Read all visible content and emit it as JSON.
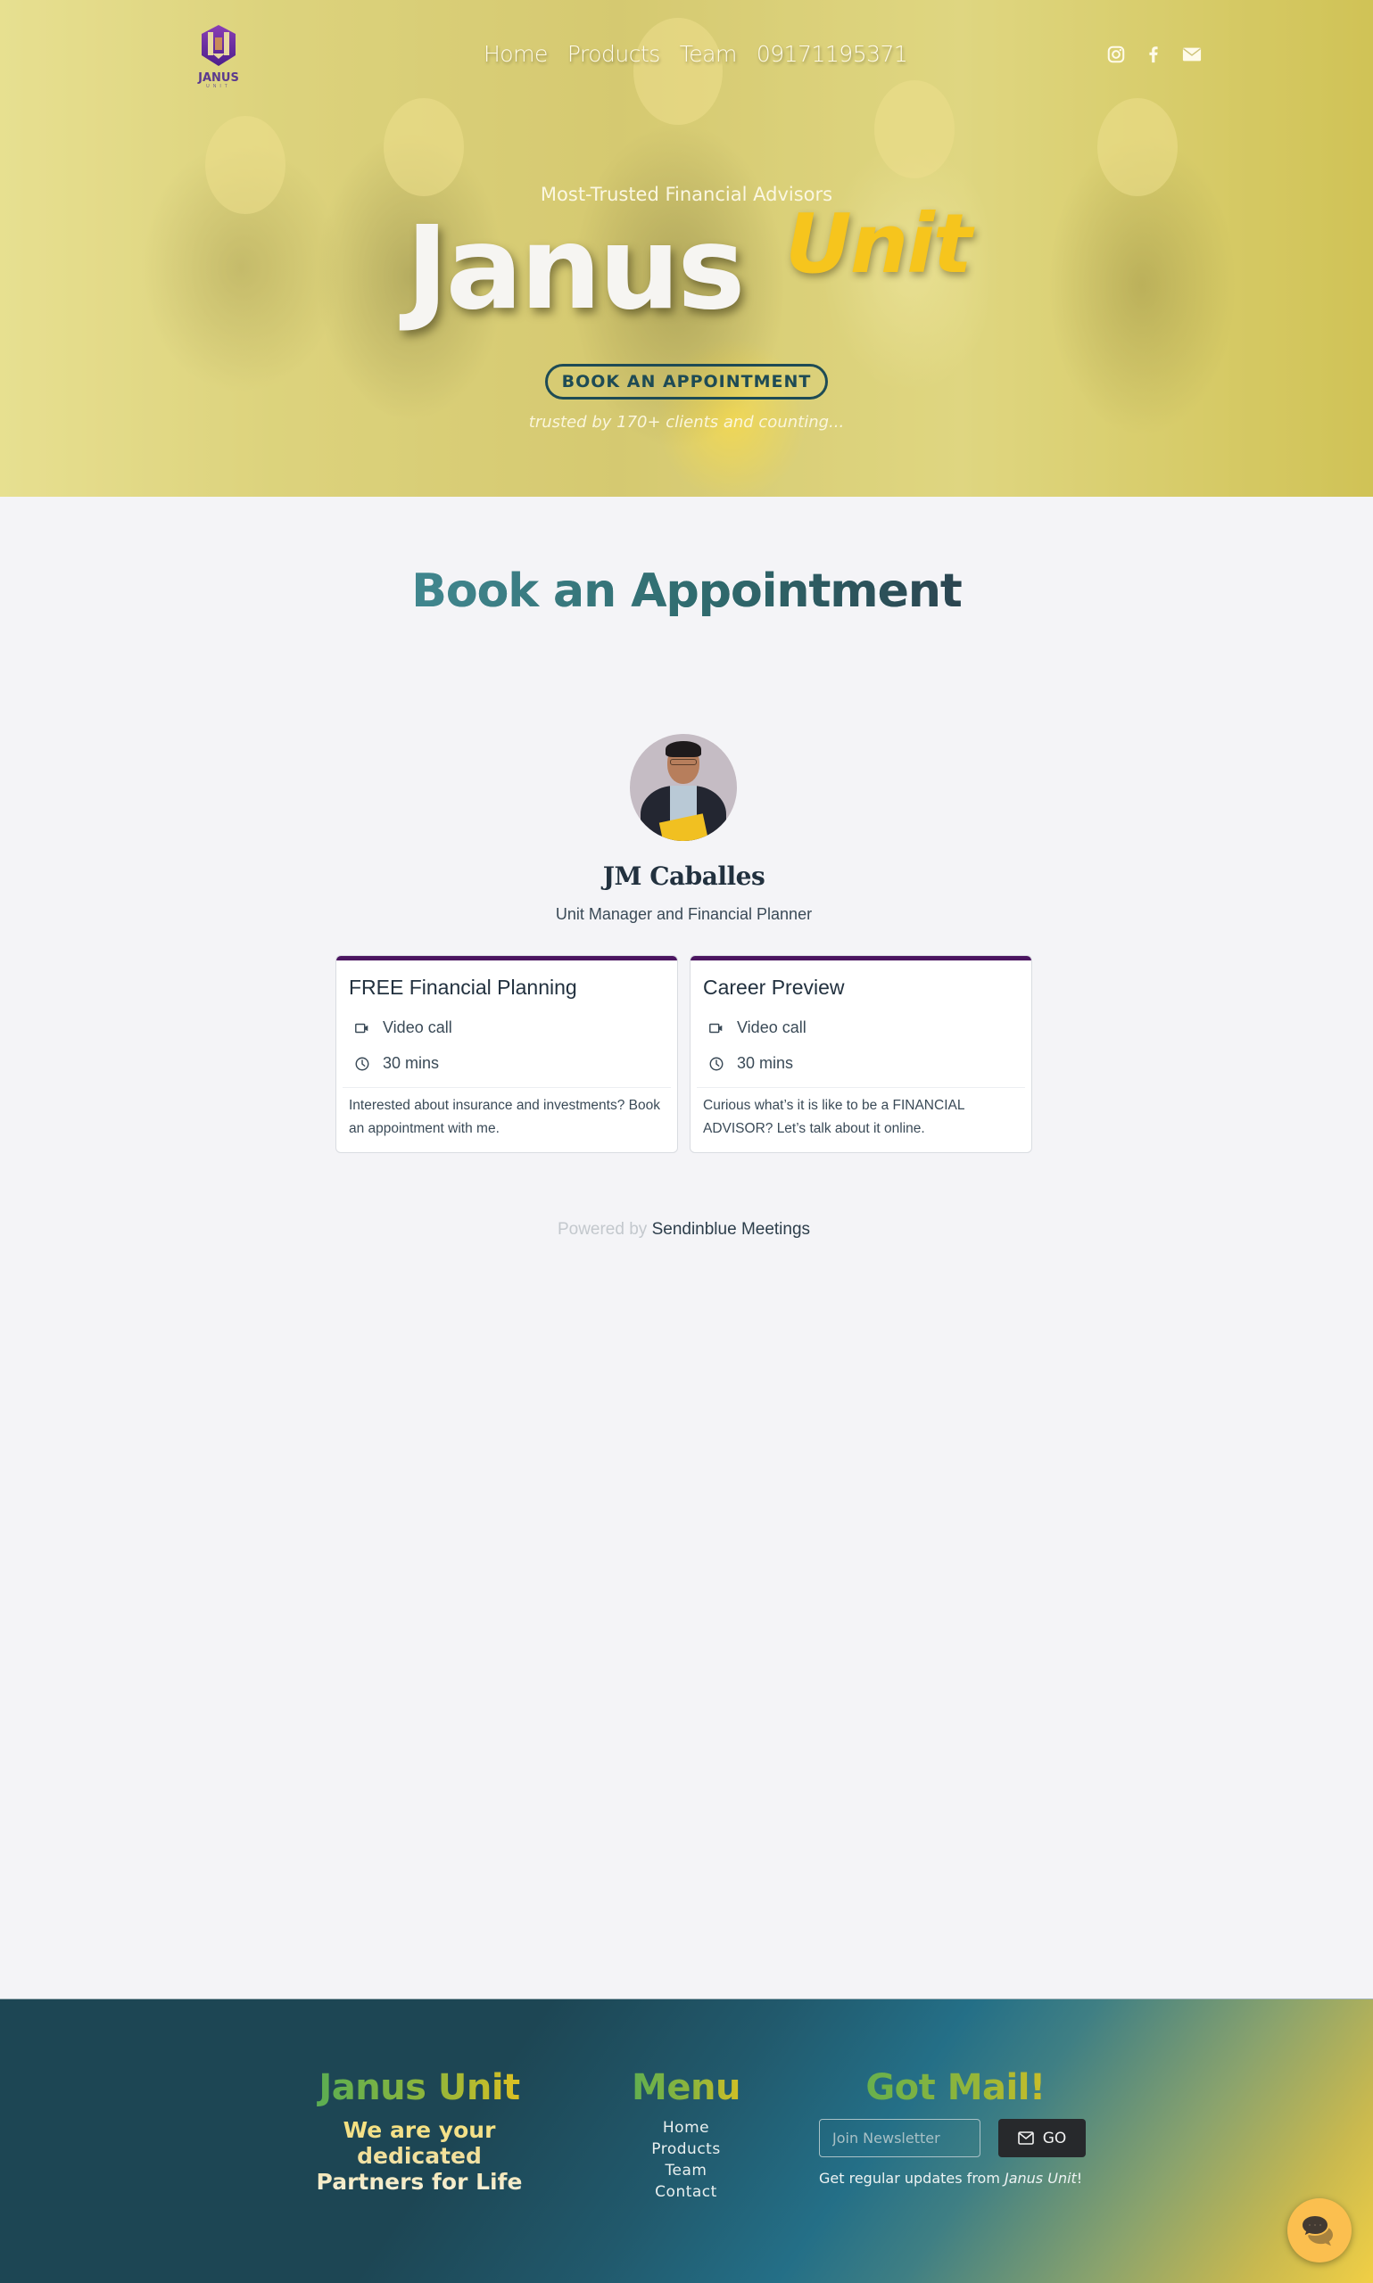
{
  "header": {
    "logo": {
      "name": "JANUS",
      "sub": "UNIT"
    },
    "nav": [
      {
        "label": "Home"
      },
      {
        "label": "Products"
      },
      {
        "label": "Team"
      },
      {
        "label": "09171195371"
      }
    ],
    "social": [
      "instagram-icon",
      "facebook-icon",
      "envelope-icon"
    ]
  },
  "hero": {
    "tagline": "Most-Trusted Financial Advisors",
    "title_main": "Janus",
    "title_accent": "Unit",
    "cta_label": "BOOK AN APPOINTMENT",
    "trust_text": "trusted by 170+ clients and counting..."
  },
  "booking": {
    "title": "Book an Appointment",
    "person": {
      "name": "JM Caballes",
      "role": "Unit Manager and Financial Planner"
    },
    "meetings": [
      {
        "title": "FREE Financial Planning",
        "type": "Video call",
        "duration": "30 mins",
        "description": "Interested about insurance and investments? Book an appointment with me."
      },
      {
        "title": "Career Preview",
        "type": "Video call",
        "duration": "30 mins",
        "description": "Curious what’s it is like to be a FINANCIAL ADVISOR? Let’s talk about it online."
      }
    ],
    "powered_prefix": "Powered by",
    "powered_link": "Sendinblue Meetings"
  },
  "footer": {
    "brand": {
      "title": "Janus Unit",
      "slogan": "We are your dedicated Partners for Life"
    },
    "menu": {
      "title": "Menu",
      "links": [
        "Home",
        "Products",
        "Team",
        "Contact"
      ]
    },
    "mail": {
      "title": "Got Mail!",
      "input_placeholder": "Join Newsletter",
      "button_label": "GO",
      "note_prefix": "Get regular updates from ",
      "note_brand": "Janus Unit",
      "note_suffix": "!"
    }
  },
  "colors": {
    "accent_yellow": "#f6c51d",
    "card_top_bar": "#4b1560",
    "title_teal": "#2f6a6d",
    "footer_dark": "#1d4654",
    "chat_button": "#fbbf4f"
  }
}
